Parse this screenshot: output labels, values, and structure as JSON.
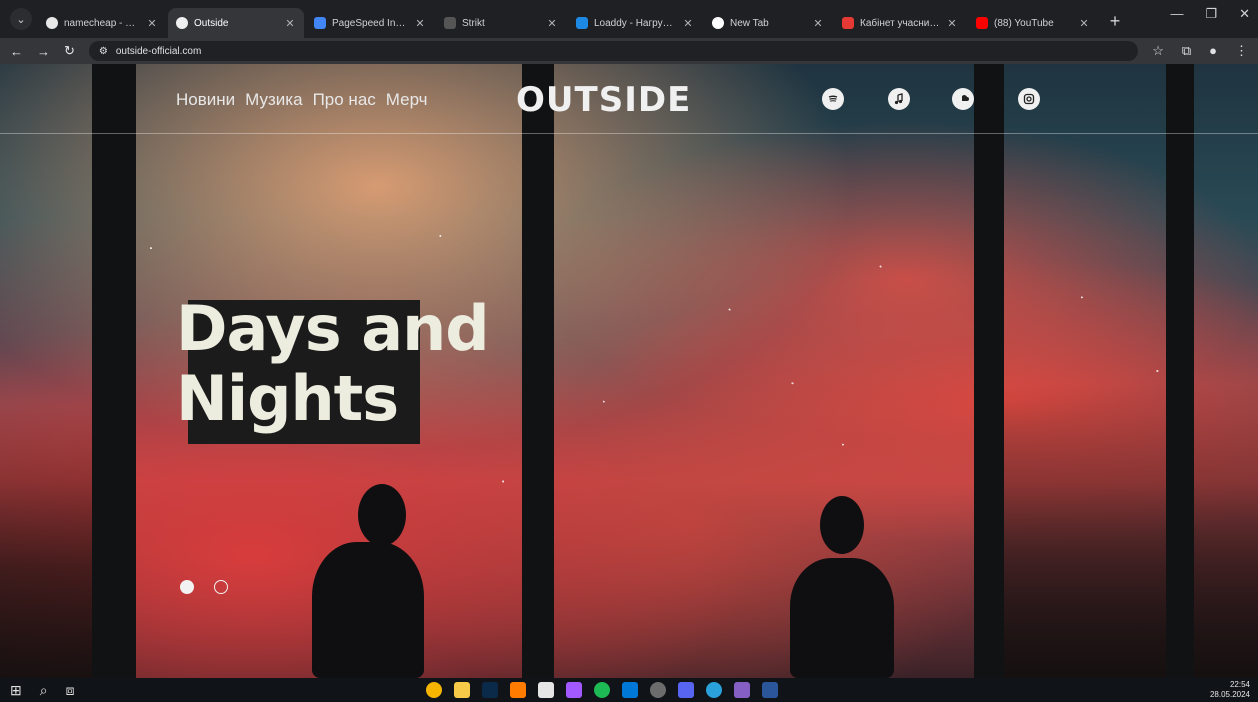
{
  "browser": {
    "tabs": [
      {
        "title": "namecheap - Поиск в Go",
        "favicon_color": "#4caf50"
      },
      {
        "title": "Outside",
        "favicon_color": "#f0f0f0",
        "active": true
      },
      {
        "title": "PageSpeed Insights",
        "favicon_color": "#4285f4"
      },
      {
        "title": "Strikt",
        "favicon_color": "#9e9e9e"
      },
      {
        "title": "Loaddy - Нагрузочное т",
        "favicon_color": "#1e88e5"
      },
      {
        "title": "New Tab",
        "favicon_color": "#ffffff"
      },
      {
        "title": "Кабінет учасника вступ",
        "favicon_color": "#e53935"
      },
      {
        "title": "(88) YouTube",
        "favicon_color": "#ff0000"
      }
    ],
    "url": "outside-official.com"
  },
  "site": {
    "nav": [
      "Новини",
      "Музика",
      "Про нас",
      "Мерч"
    ],
    "logo": "OUTSIDE",
    "social_icons": [
      "spotify-icon",
      "apple-music-icon",
      "soundcloud-icon",
      "instagram-icon"
    ],
    "hero_title": "Days and\nNights",
    "slider": {
      "count": 2,
      "active_index": 0
    }
  },
  "taskbar": {
    "time": "22:54",
    "date": "28.05.2024",
    "apps": [
      "chrome-icon",
      "files-icon",
      "photoshop-icon",
      "illustrator-icon",
      "notion-icon",
      "figma-icon",
      "spotify-icon",
      "vscode-icon",
      "obs-icon",
      "discord-icon",
      "telegram-icon",
      "vs-icon",
      "word-icon"
    ]
  },
  "colors": {
    "accent_text": "#ececdf",
    "tab_active": "#35363a",
    "toolbar": "#1f2023"
  }
}
